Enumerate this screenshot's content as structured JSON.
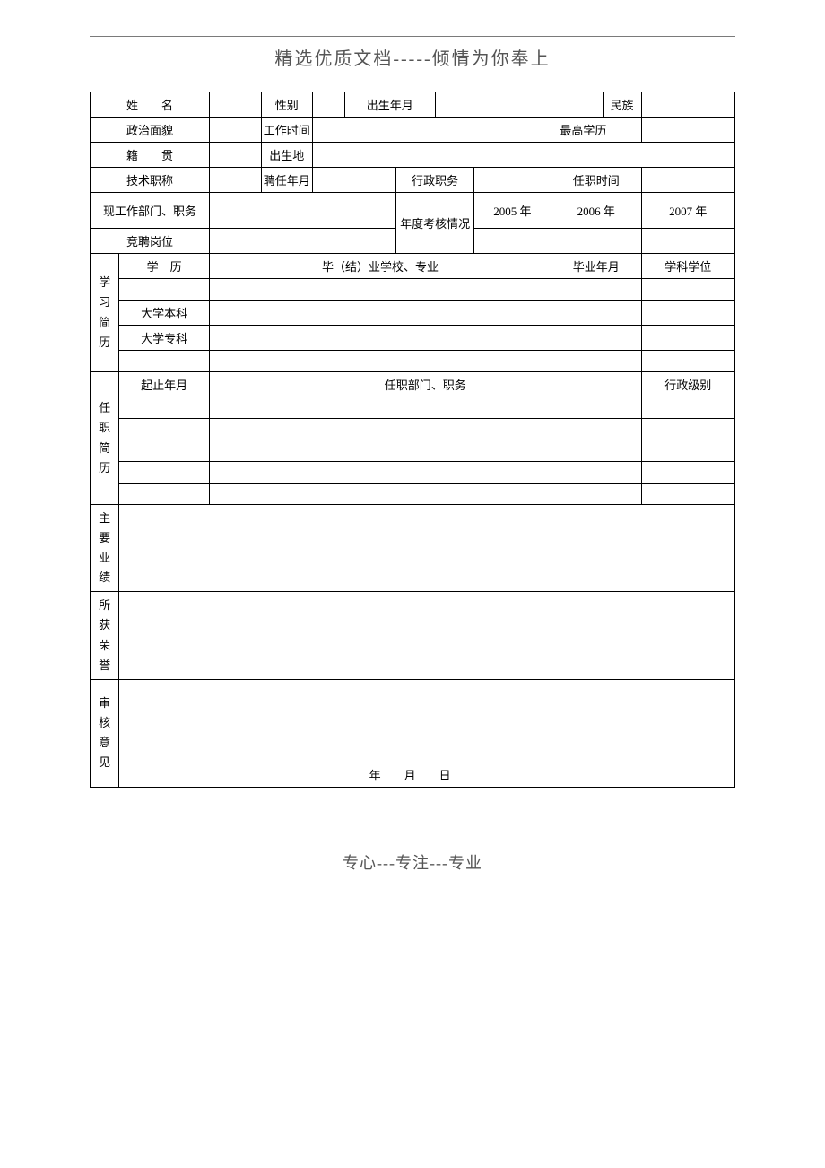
{
  "header": "精选优质文档-----倾情为你奉上",
  "labels": {
    "name": "姓　　名",
    "gender": "性别",
    "birth": "出生年月",
    "ethnicity": "民族",
    "politics": "政治面貌",
    "worktime": "工作时间",
    "edu_highest": "最高学历",
    "native": "籍　　贯",
    "birthplace": "出生地",
    "title": "技术职称",
    "appoint_ym": "聘任年月",
    "admin_post": "行政职务",
    "appoint_time": "任职时间",
    "current_dept": "现工作部门、职务",
    "annual_review": "年度考核情况",
    "y1": "2005 年",
    "y2": "2006 年",
    "y3": "2007 年",
    "compete_post": "竞聘岗位",
    "edu_history": "学习简历",
    "edu_level": "学　历",
    "school_major": "毕（结）业学校、专业",
    "grad_ym": "毕业年月",
    "degree": "学科学位",
    "bachelor": "大学本科",
    "associate": "大学专科",
    "job_history": "任职简历",
    "period": "起止年月",
    "dept_post": "任职部门、职务",
    "admin_level": "行政级别",
    "achievements": "主要业绩",
    "honors": "所获荣誉",
    "review": "审核意见",
    "date": "年　　月　　日"
  },
  "values": {
    "name": "",
    "gender": "",
    "birth": "",
    "ethnicity": "",
    "politics": "",
    "worktime": "",
    "edu_highest": "",
    "native": "",
    "birthplace": "",
    "title": "",
    "appoint_ym": "",
    "admin_post": "",
    "appoint_time": "",
    "current_dept": "",
    "compete_post": "",
    "y1": "",
    "y2": "",
    "y3": ""
  },
  "footer": "专心---专注---专业"
}
